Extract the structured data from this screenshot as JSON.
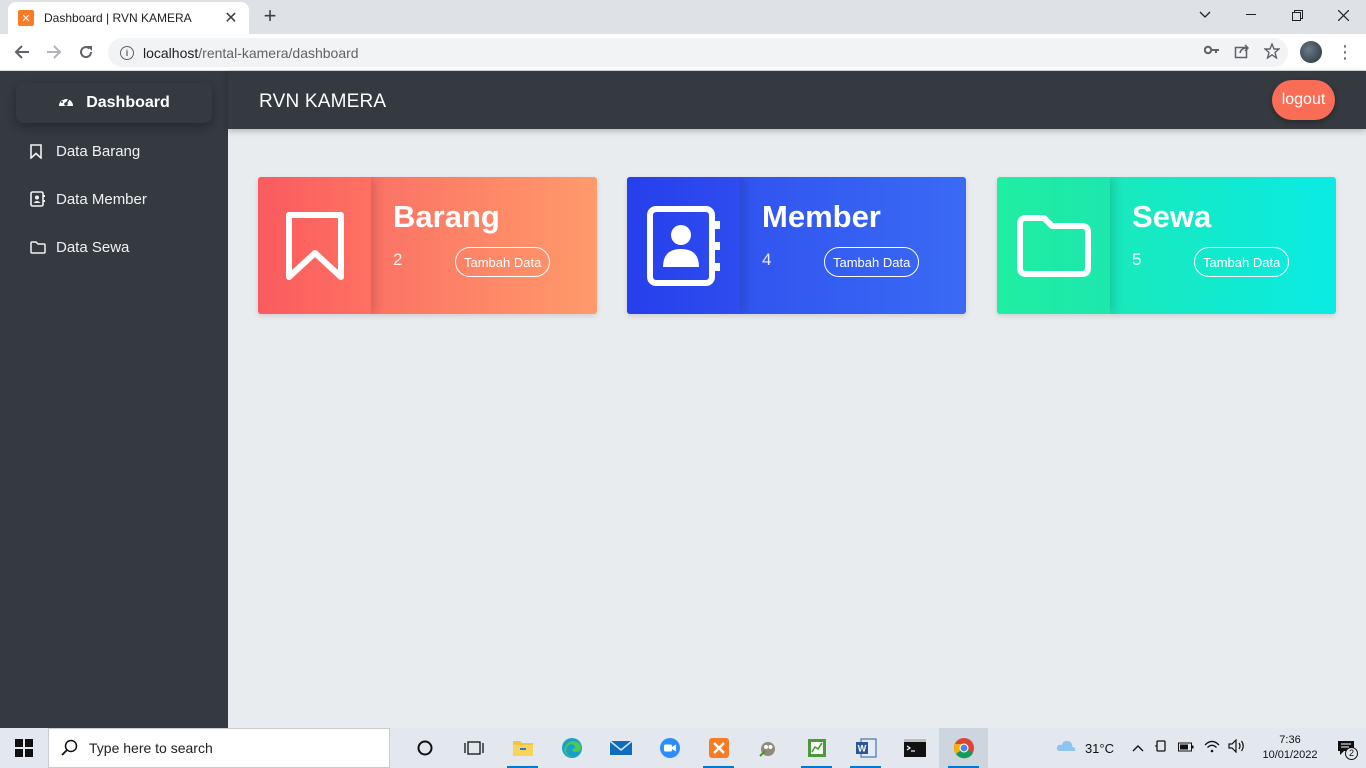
{
  "browser": {
    "tab_title": "Dashboard | RVN KAMERA",
    "tab_favicon": "xampp-icon",
    "url_host": "localhost",
    "url_path": "/rental-kamera/dashboard"
  },
  "sidebar": {
    "active_item": "Dashboard",
    "items": [
      {
        "label": "Data Barang",
        "icon": "bookmark-icon"
      },
      {
        "label": "Data Member",
        "icon": "contact-book-icon"
      },
      {
        "label": "Data Sewa",
        "icon": "folder-icon"
      }
    ]
  },
  "header": {
    "brand": "RVN KAMERA",
    "logout_label": "logout"
  },
  "cards": [
    {
      "title": "Barang",
      "count": "2",
      "button": "Tambah Data",
      "icon": "bookmark-icon",
      "color": "#fa5f63"
    },
    {
      "title": "Member",
      "count": "4",
      "button": "Tambah Data",
      "icon": "contact-book-icon",
      "color": "#2c49ee"
    },
    {
      "title": "Sewa",
      "count": "5",
      "button": "Tambah Data",
      "icon": "folder-icon",
      "color": "#21e9a6"
    }
  ],
  "taskbar": {
    "search_placeholder": "Type here to search",
    "temperature": "31°C",
    "time": "7:36",
    "date": "10/01/2022",
    "notification_count": "2"
  }
}
